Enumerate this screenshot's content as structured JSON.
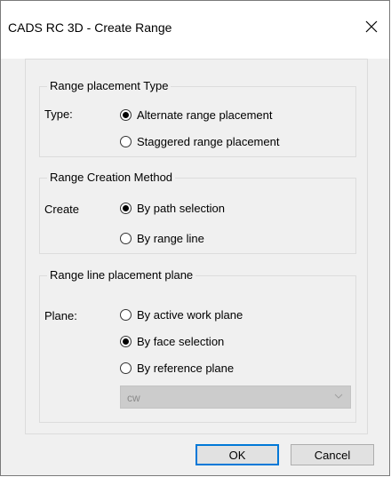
{
  "window": {
    "title": "CADS RC 3D - Create Range"
  },
  "placement_type": {
    "legend": "Range placement Type",
    "label": "Type:",
    "options": [
      {
        "label": "Alternate range placement",
        "checked": true
      },
      {
        "label": "Staggered range placement",
        "checked": false
      }
    ]
  },
  "creation_method": {
    "legend": "Range Creation Method",
    "label": "Create",
    "options": [
      {
        "label": "By path selection",
        "checked": true
      },
      {
        "label": "By range line",
        "checked": false
      }
    ]
  },
  "placement_plane": {
    "legend": "Range line placement plane",
    "label": "Plane:",
    "options": [
      {
        "label": "By active work plane",
        "checked": false
      },
      {
        "label": "By face selection",
        "checked": true
      },
      {
        "label": "By reference plane",
        "checked": false
      }
    ],
    "plane_select": {
      "value": "cw",
      "disabled": true
    }
  },
  "buttons": {
    "ok": "OK",
    "cancel": "Cancel"
  },
  "colors": {
    "accent": "#0078d7",
    "disabled_field": "#cccccc"
  }
}
